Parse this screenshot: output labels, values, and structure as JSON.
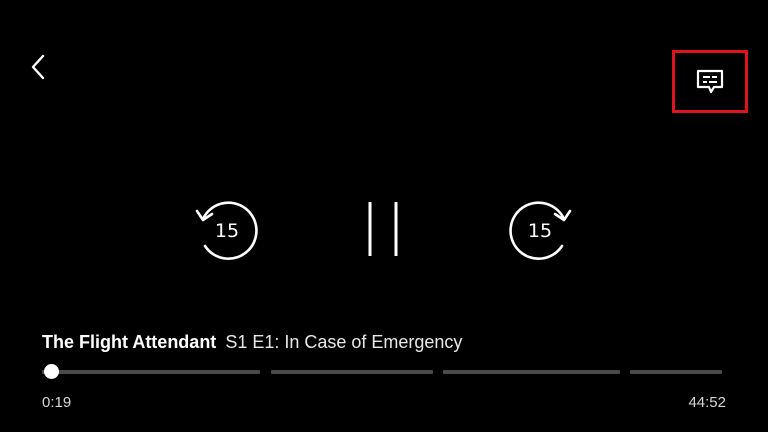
{
  "colors": {
    "background": "#000000",
    "foreground": "#ffffff",
    "highlight_border": "#e0141e",
    "track": "#4a4a4a"
  },
  "top_bar": {
    "back_icon": "chevron-left-icon",
    "subtitles_icon": "subtitles-speech-bubble-icon"
  },
  "controls": {
    "skip_back_icon": "rewind-15-icon",
    "skip_back_label": "15",
    "pause_icon": "pause-icon",
    "skip_forward_icon": "forward-15-icon",
    "skip_forward_label": "15"
  },
  "now_playing": {
    "show_title": "The Flight Attendant",
    "episode_title": "S1 E1: In Case of Emergency"
  },
  "progress": {
    "elapsed": "0:19",
    "total": "44:52",
    "fraction": 0.007
  }
}
